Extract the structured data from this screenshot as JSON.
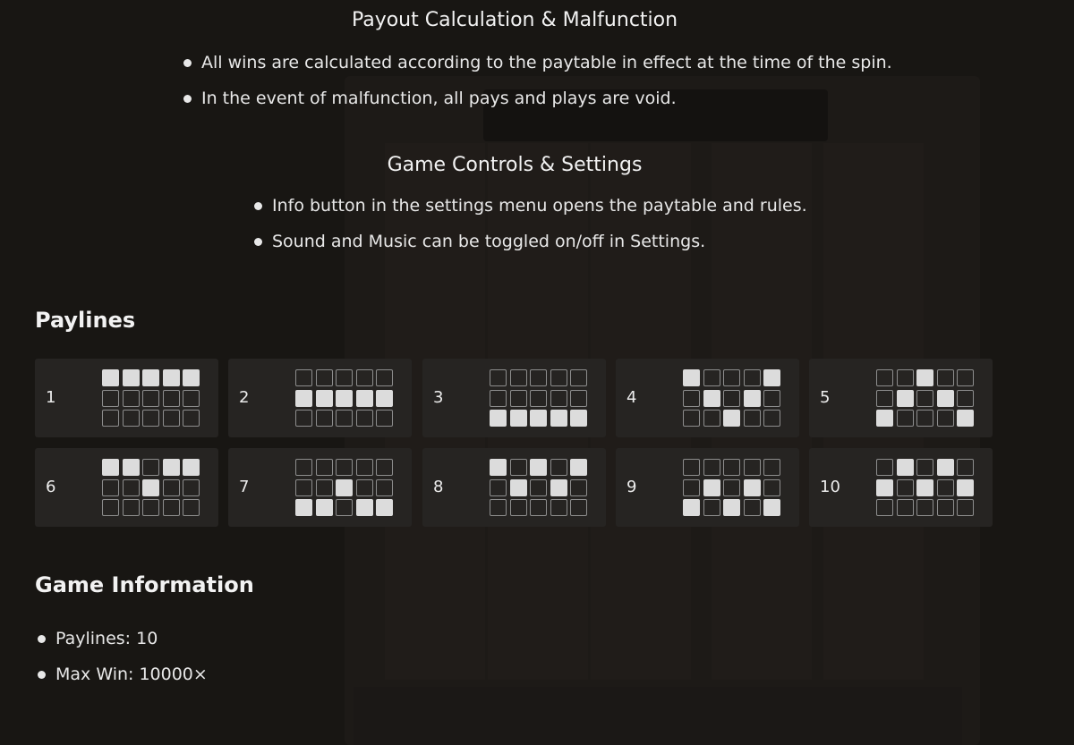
{
  "payout_section": {
    "title": "Payout Calculation & Malfunction",
    "bullets": [
      "All wins are calculated according to the paytable in effect at the time of the spin.",
      "In the event of malfunction, all pays and plays are void."
    ]
  },
  "controls_section": {
    "title": "Game Controls & Settings",
    "bullets": [
      "Info button in the settings menu opens the paytable and rules.",
      "Sound and Music can be toggled on/off in Settings."
    ]
  },
  "paylines_section": {
    "title": "Paylines",
    "lines": [
      {
        "number": "1",
        "rows": [
          1,
          1,
          1,
          1,
          1
        ]
      },
      {
        "number": "2",
        "rows": [
          2,
          2,
          2,
          2,
          2
        ]
      },
      {
        "number": "3",
        "rows": [
          3,
          3,
          3,
          3,
          3
        ]
      },
      {
        "number": "4",
        "rows": [
          1,
          2,
          3,
          2,
          1
        ]
      },
      {
        "number": "5",
        "rows": [
          3,
          2,
          1,
          2,
          3
        ]
      },
      {
        "number": "6",
        "rows": [
          1,
          1,
          2,
          1,
          1
        ]
      },
      {
        "number": "7",
        "rows": [
          3,
          3,
          2,
          3,
          3
        ]
      },
      {
        "number": "8",
        "rows": [
          1,
          2,
          1,
          2,
          1
        ]
      },
      {
        "number": "9",
        "rows": [
          3,
          2,
          3,
          2,
          3
        ]
      },
      {
        "number": "10",
        "rows": [
          2,
          1,
          2,
          1,
          2
        ]
      }
    ]
  },
  "game_info_section": {
    "title": "Game Information",
    "bullets": [
      "Paylines: 10",
      "Max Win: 10000×"
    ]
  },
  "colors": {
    "background": "#181613",
    "card": "#262422",
    "cell_on": "#dcdcdc",
    "cell_border": "#8d8d8d"
  }
}
